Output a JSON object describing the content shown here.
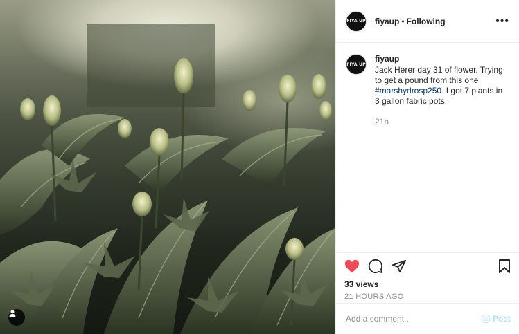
{
  "post": {
    "username": "fiyaup",
    "avatar_text": "FIYA UP",
    "separator": "•",
    "follow_status": "Following",
    "more_icon": "more-horizontal-icon",
    "caption": {
      "username": "fiyaup",
      "text_before": "Jack Herer day 31 of flower. Trying to get a pound from this one ",
      "hashtag": "#marshydrosp250",
      "text_after": ". I got 7 plants in 3 gallon fabric pots.",
      "time": "21h"
    },
    "views": "33 views",
    "time_ago": "21 HOURS AGO",
    "comment_placeholder": "Add a comment...",
    "post_label": "Post"
  },
  "icons": [
    "heart-icon",
    "comment-icon",
    "share-icon",
    "bookmark-icon",
    "user-tag-icon",
    "emoji-icon"
  ],
  "colors": {
    "like_red": "#ed4956",
    "text": "#262626",
    "muted": "#8e8e8e",
    "hashtag": "#00376b",
    "post_disabled": "#b2dffc"
  }
}
